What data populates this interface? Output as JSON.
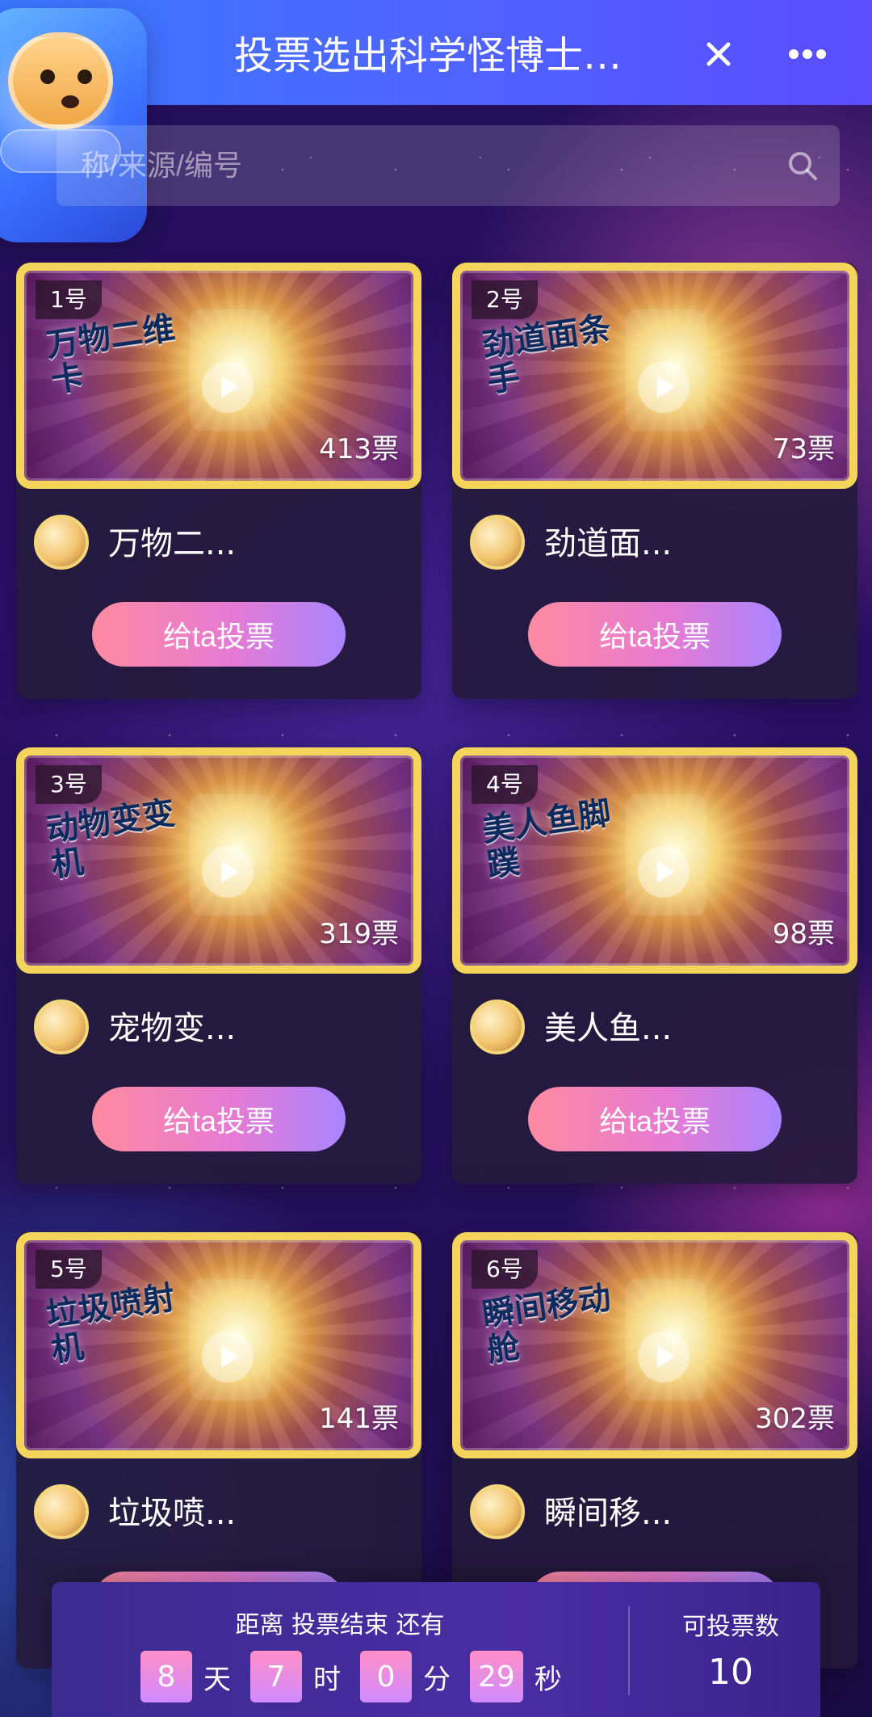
{
  "header": {
    "title": "投票选出科学怪博士…",
    "close_icon": "close-icon",
    "more_icon": "more-icon"
  },
  "search": {
    "placeholder": "称/来源/编号",
    "icon": "search-icon"
  },
  "cards": [
    {
      "num": "1号",
      "votes": "413票",
      "name": "万物二...",
      "button": "给ta投票",
      "overlay": "万物二维卡"
    },
    {
      "num": "2号",
      "votes": "73票",
      "name": "劲道面...",
      "button": "给ta投票",
      "overlay": "劲道面条手"
    },
    {
      "num": "3号",
      "votes": "319票",
      "name": "宠物变...",
      "button": "给ta投票",
      "overlay": "动物变变机"
    },
    {
      "num": "4号",
      "votes": "98票",
      "name": "美人鱼...",
      "button": "给ta投票",
      "overlay": "美人鱼脚蹼"
    },
    {
      "num": "5号",
      "votes": "141票",
      "name": "垃圾喷...",
      "button": "",
      "overlay": "垃圾喷射机"
    },
    {
      "num": "6号",
      "votes": "302票",
      "name": "瞬间移...",
      "button": "",
      "overlay": "瞬间移动舱"
    }
  ],
  "bottom": {
    "countdown_title": "距离 投票结束 还有",
    "countdown": {
      "days": "8",
      "days_unit": "天",
      "hours": "7",
      "hours_unit": "时",
      "minutes": "0",
      "minutes_unit": "分",
      "seconds": "29",
      "seconds_unit": "秒"
    },
    "votes_left_title": "可投票数",
    "votes_left": "10"
  }
}
